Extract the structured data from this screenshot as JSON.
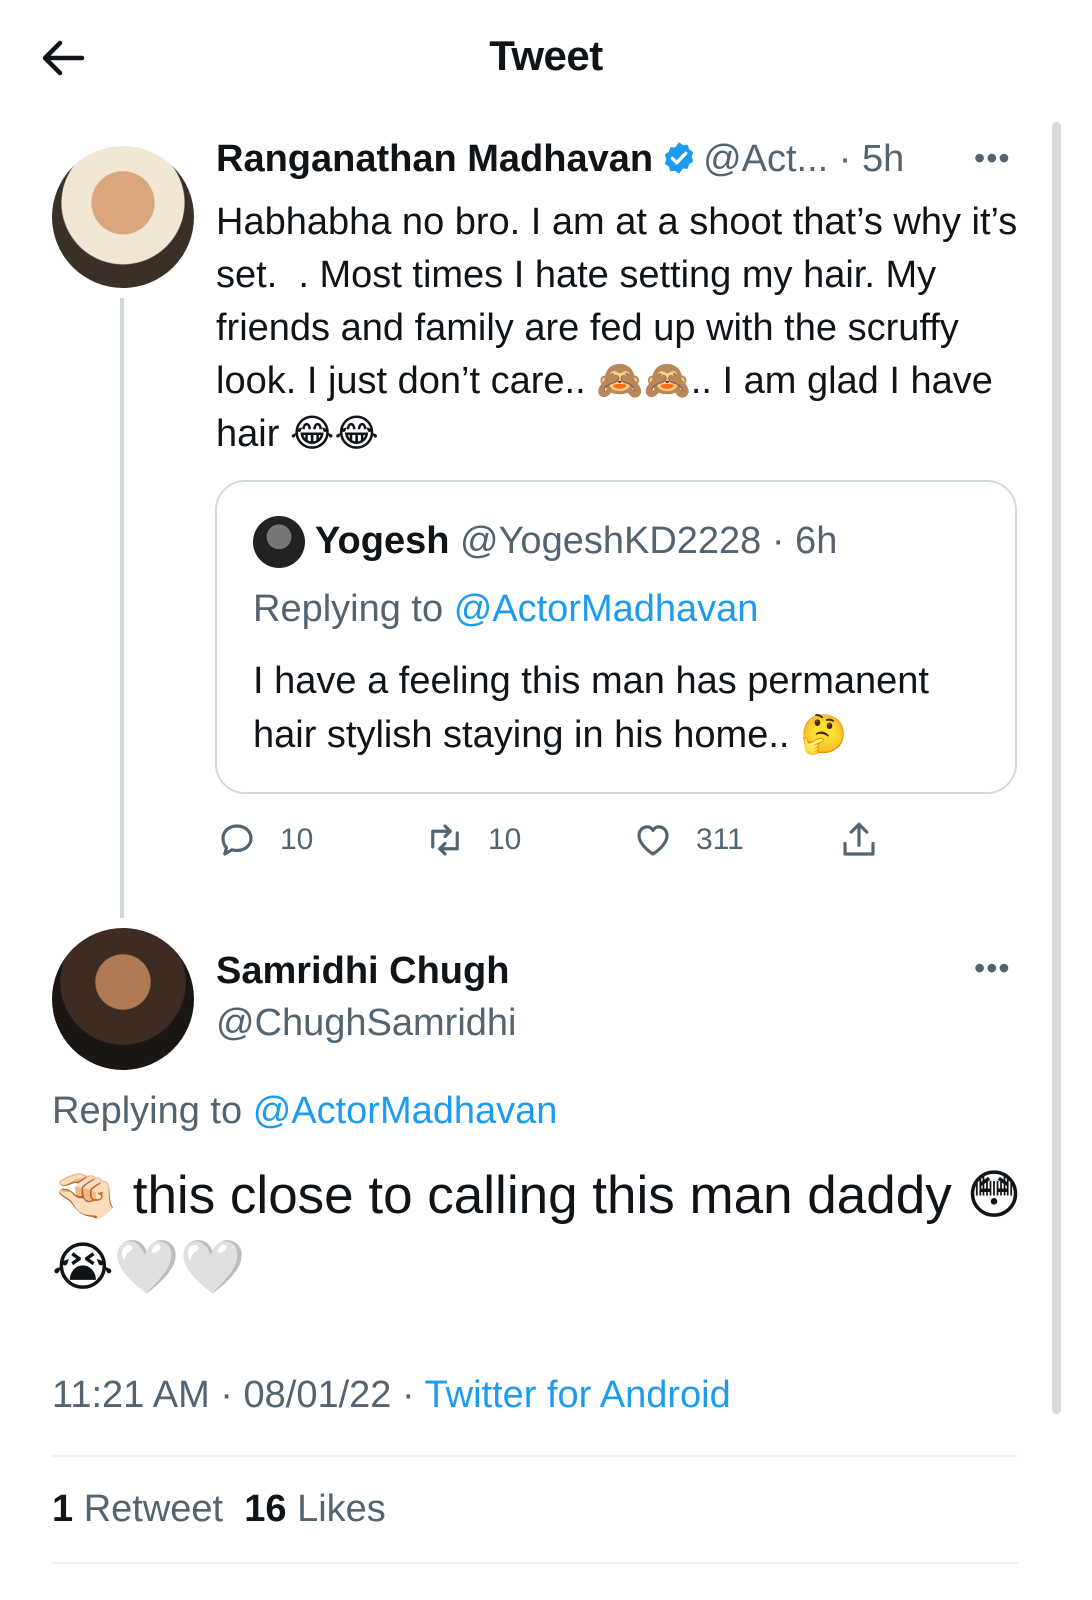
{
  "header": {
    "title": "Tweet"
  },
  "icons": {
    "back": "arrow-left-icon",
    "verified": "verified-badge-icon",
    "more": "more-options-icon",
    "reply": "reply-icon",
    "retweet": "retweet-icon",
    "like": "heart-icon",
    "share": "share-icon"
  },
  "colors": {
    "link": "#1d9bf0",
    "secondary_text": "#536471"
  },
  "main_tweet": {
    "author_name": "Ranganathan Madhavan",
    "meta": "@Act... · 5h",
    "text": "Habhabha no bro. I am at a shoot that’s why it’s set.  . Most times I hate setting my hair. My friends and family are fed up with the scruffy look. I just don’t care.. 🙈🙈.. I am glad I have hair 😂😂",
    "more": "•••",
    "quote": {
      "name": "Yogesh",
      "meta": "@YogeshKD2228 · 6h",
      "replying_label": "Replying to",
      "replying_to": "@ActorMadhavan",
      "text": "I have a feeling this man has permanent hair stylish staying in his home.. 🤔"
    },
    "actions": {
      "replies": "10",
      "retweets": "10",
      "likes": "311"
    }
  },
  "reply_tweet": {
    "author_name": "Samridhi Chugh",
    "handle": "@ChughSamridhi",
    "more": "•••",
    "replying_label": "Replying to",
    "replying_to": "@ActorMadhavan",
    "text": "🤏🏻 this close to calling this man daddy 😳😭🤍🤍",
    "time_date": "11:21 AM · 08/01/22 · ",
    "source": "Twitter for Android",
    "retweets_count": "1",
    "retweets_label": "Retweet",
    "likes_count": "16",
    "likes_label": "Likes"
  }
}
